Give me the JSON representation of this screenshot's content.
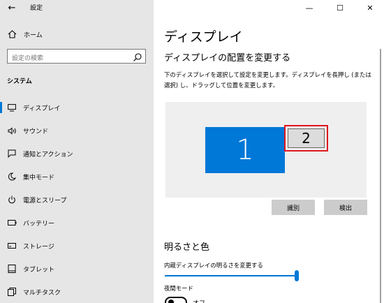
{
  "window": {
    "title": "設定",
    "minimize_glyph": "—",
    "maximize_glyph": "☐",
    "close_glyph": "✕",
    "back_glyph": "←"
  },
  "sidebar": {
    "home_label": "ホーム",
    "search_placeholder": "設定の検索",
    "section_heading": "システム",
    "items": [
      {
        "label": "ディスプレイ",
        "icon": "monitor-icon",
        "active": true
      },
      {
        "label": "サウンド",
        "icon": "speaker-icon",
        "active": false
      },
      {
        "label": "通知とアクション",
        "icon": "notification-icon",
        "active": false
      },
      {
        "label": "集中モード",
        "icon": "moon-icon",
        "active": false
      },
      {
        "label": "電源とスリープ",
        "icon": "power-icon",
        "active": false
      },
      {
        "label": "バッテリー",
        "icon": "battery-icon",
        "active": false
      },
      {
        "label": "ストレージ",
        "icon": "storage-icon",
        "active": false
      },
      {
        "label": "タブレット",
        "icon": "tablet-icon",
        "active": false
      },
      {
        "label": "マルチタスク",
        "icon": "multitask-icon",
        "active": false
      }
    ]
  },
  "main": {
    "page_title": "ディスプレイ",
    "arrange_heading": "ディスプレイの配置を変更する",
    "description": "下のディスプレイを選択して設定を変更します。ディスプレイを長押し (または選択) し、ドラッグして位置を変更します。",
    "monitors": [
      {
        "label": "1",
        "selected": false
      },
      {
        "label": "2",
        "selected": true
      }
    ],
    "identify_button": "識別",
    "detect_button": "検出",
    "brightness_heading": "明るさと色",
    "brightness_label": "内蔵ディスプレイの明るさを変更する",
    "brightness_value": 1.0,
    "night_mode_label": "夜間モード",
    "night_mode_state": "オフ"
  },
  "colors": {
    "accent": "#0078d7",
    "selection_outline": "#e0161d",
    "sidebar_bg": "#e6e6e6"
  }
}
